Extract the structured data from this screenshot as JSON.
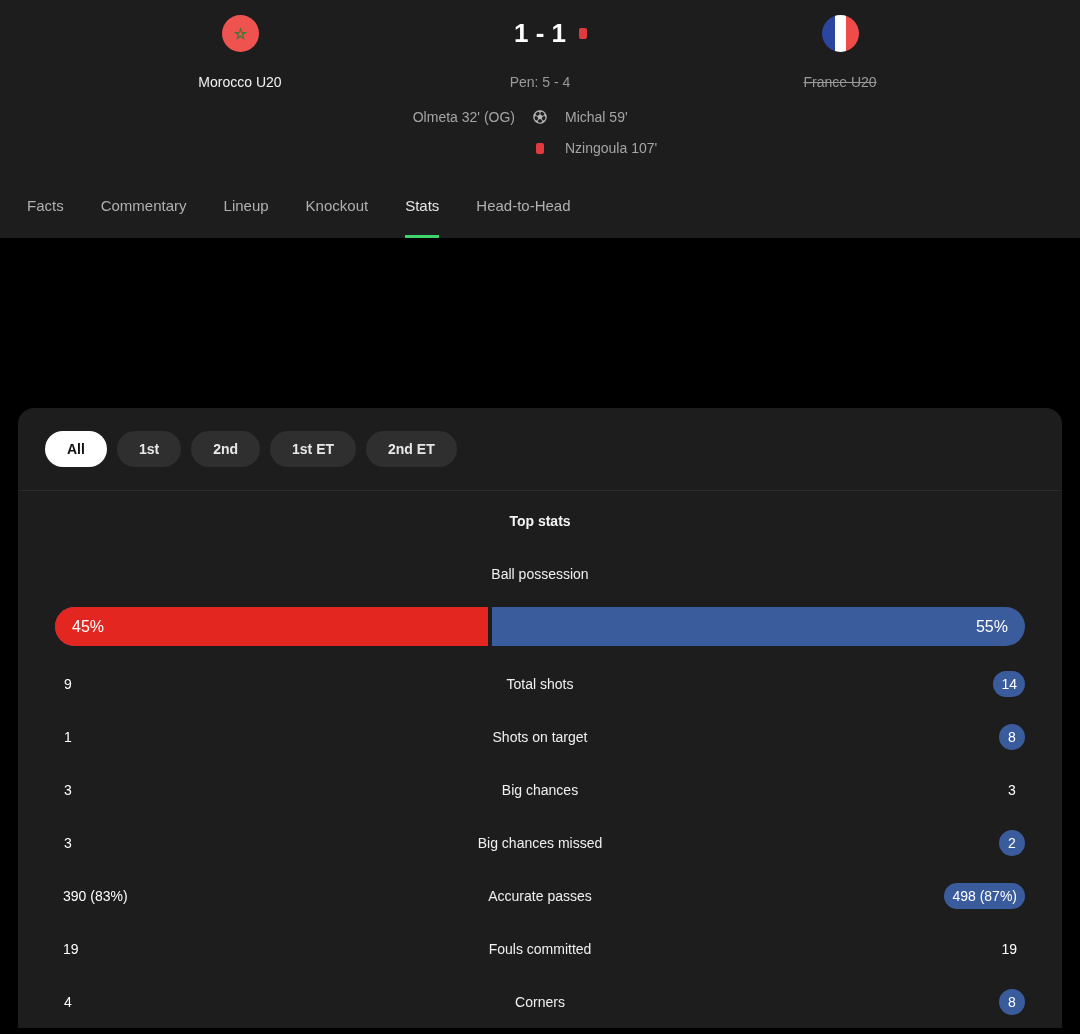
{
  "teams": [
    {
      "name": "Morocco U20",
      "color": "#e3261f",
      "eliminated": false,
      "red_card": false
    },
    {
      "name": "France U20",
      "color": "#3a5b9c",
      "eliminated": true,
      "red_card": true
    }
  ],
  "score": "1 - 1",
  "penalties": "Pen: 5 - 4",
  "events": [
    {
      "kind": "goal",
      "home": "Olmeta 32' (OG)",
      "away": "Michal 59'"
    },
    {
      "kind": "red_card",
      "away": "Nzingoula 107'"
    }
  ],
  "tabs": [
    {
      "label": "Facts",
      "selected": false
    },
    {
      "label": "Commentary",
      "selected": false
    },
    {
      "label": "Lineup",
      "selected": false
    },
    {
      "label": "Knockout",
      "selected": false
    },
    {
      "label": "Stats",
      "selected": true
    },
    {
      "label": "Head-to-Head",
      "selected": false
    }
  ],
  "periods": [
    {
      "label": "All",
      "selected": true
    },
    {
      "label": "1st",
      "selected": false
    },
    {
      "label": "2nd",
      "selected": false
    },
    {
      "label": "1st ET",
      "selected": false
    },
    {
      "label": "2nd ET",
      "selected": false
    }
  ],
  "section_title": "Top stats",
  "possession": {
    "label": "Ball possession",
    "level": 0.45,
    "values": [
      "45%",
      "55%"
    ]
  },
  "stats": [
    {
      "label": "Total shots",
      "values": [
        {
          "text": "9",
          "highlighted": false
        },
        {
          "text": "14",
          "highlighted": true
        }
      ]
    },
    {
      "label": "Shots on target",
      "values": [
        {
          "text": "1",
          "highlighted": false
        },
        {
          "text": "8",
          "highlighted": true
        }
      ]
    },
    {
      "label": "Big chances",
      "values": [
        {
          "text": "3",
          "highlighted": false
        },
        {
          "text": "3",
          "highlighted": false
        }
      ]
    },
    {
      "label": "Big chances missed",
      "values": [
        {
          "text": "3",
          "highlighted": false
        },
        {
          "text": "2",
          "highlighted": true
        }
      ]
    },
    {
      "label": "Accurate passes",
      "values": [
        {
          "text": "390 (83%)",
          "highlighted": false
        },
        {
          "text": "498 (87%)",
          "highlighted": true
        }
      ]
    },
    {
      "label": "Fouls committed",
      "values": [
        {
          "text": "19",
          "highlighted": false
        },
        {
          "text": "19",
          "highlighted": false
        }
      ]
    },
    {
      "label": "Corners",
      "values": [
        {
          "text": "4",
          "highlighted": false
        },
        {
          "text": "8",
          "highlighted": true
        }
      ]
    }
  ]
}
